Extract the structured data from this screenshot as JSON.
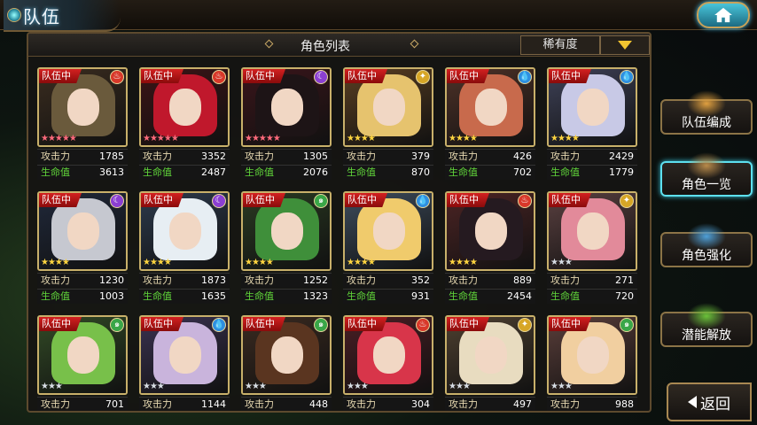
{
  "header": {
    "title": "队伍"
  },
  "panel": {
    "title": "角色列表",
    "sort_label": "稀有度"
  },
  "stat_labels": {
    "atk": "攻击力",
    "hp": "生命值"
  },
  "cards": [
    {
      "tag": "队伍中",
      "element": "fire",
      "stars": 5,
      "atk": "1785",
      "hp": "3613",
      "hair": "#6a5a3c",
      "bg": "#3a2c1f"
    },
    {
      "tag": "队伍中",
      "element": "fire",
      "stars": 5,
      "atk": "3352",
      "hp": "2487",
      "hair": "#c0182c",
      "bg": "#3b1416"
    },
    {
      "tag": "队伍中",
      "element": "dark",
      "stars": 5,
      "atk": "1305",
      "hp": "2076",
      "hair": "#1d1416",
      "bg": "#3a151a"
    },
    {
      "tag": "队伍中",
      "element": "light",
      "stars": 4,
      "atk": "379",
      "hp": "870",
      "hair": "#e6c36e",
      "bg": "#5a3f22"
    },
    {
      "tag": "队伍中",
      "element": "water",
      "stars": 4,
      "atk": "426",
      "hp": "702",
      "hair": "#c86a4c",
      "bg": "#4e3228"
    },
    {
      "tag": "队伍中",
      "element": "water",
      "stars": 4,
      "atk": "2429",
      "hp": "1779",
      "hair": "#c8c9e6",
      "bg": "#3e4157"
    },
    {
      "tag": "队伍中",
      "element": "dark",
      "stars": 4,
      "atk": "1230",
      "hp": "1003",
      "hair": "#c6c8d0",
      "bg": "#20283a"
    },
    {
      "tag": "队伍中",
      "element": "dark",
      "stars": 4,
      "atk": "1873",
      "hp": "1635",
      "hair": "#e7eef3",
      "bg": "#2d3a4c"
    },
    {
      "tag": "队伍中",
      "element": "wind",
      "stars": 4,
      "atk": "1252",
      "hp": "1323",
      "hair": "#3f8f3a",
      "bg": "#2a3a22"
    },
    {
      "tag": "队伍中",
      "element": "water",
      "stars": 4,
      "atk": "352",
      "hp": "931",
      "hair": "#f0cb6c",
      "bg": "#3e4c5c"
    },
    {
      "tag": "队伍中",
      "element": "fire",
      "stars": 4,
      "atk": "889",
      "hp": "2454",
      "hair": "#251a20",
      "bg": "#4c2424"
    },
    {
      "tag": "队伍中",
      "element": "light",
      "stars": 3,
      "atk": "271",
      "hp": "720",
      "hair": "#e28a9a",
      "bg": "#5a4040"
    },
    {
      "tag": "队伍中",
      "element": "wind",
      "stars": 3,
      "atk": "701",
      "hp": "",
      "hair": "#78c04a",
      "bg": "#324a26"
    },
    {
      "tag": "队伍中",
      "element": "water",
      "stars": 3,
      "atk": "1144",
      "hp": "",
      "hair": "#c9b4dc",
      "bg": "#3a3250"
    },
    {
      "tag": "队伍中",
      "element": "wind",
      "stars": 3,
      "atk": "448",
      "hp": "",
      "hair": "#5a3520",
      "bg": "#3a2a20"
    },
    {
      "tag": "队伍中",
      "element": "fire",
      "stars": 3,
      "atk": "304",
      "hp": "",
      "hair": "#d8354a",
      "bg": "#4a1e24"
    },
    {
      "tag": "队伍中",
      "element": "light",
      "stars": 3,
      "atk": "497",
      "hp": "",
      "hair": "#e8dcc0",
      "bg": "#4e4030"
    },
    {
      "tag": "队伍中",
      "element": "wind",
      "stars": 3,
      "atk": "988",
      "hp": "",
      "hair": "#f1cfa0",
      "bg": "#5a3e3a"
    }
  ],
  "side_menu": [
    {
      "label": "队伍编成",
      "active": false,
      "icon": "team-icon"
    },
    {
      "label": "角色一览",
      "active": true,
      "icon": "book-icon"
    },
    {
      "label": "角色强化",
      "active": false,
      "icon": "enhance-icon"
    },
    {
      "label": "潜能解放",
      "active": false,
      "icon": "potential-icon"
    }
  ],
  "back_label": "返回",
  "colors": {
    "fire": "#d8382a",
    "water": "#2f8fe0",
    "wind": "#3aa648",
    "light": "#d7a626",
    "dark": "#8b3fd2"
  }
}
